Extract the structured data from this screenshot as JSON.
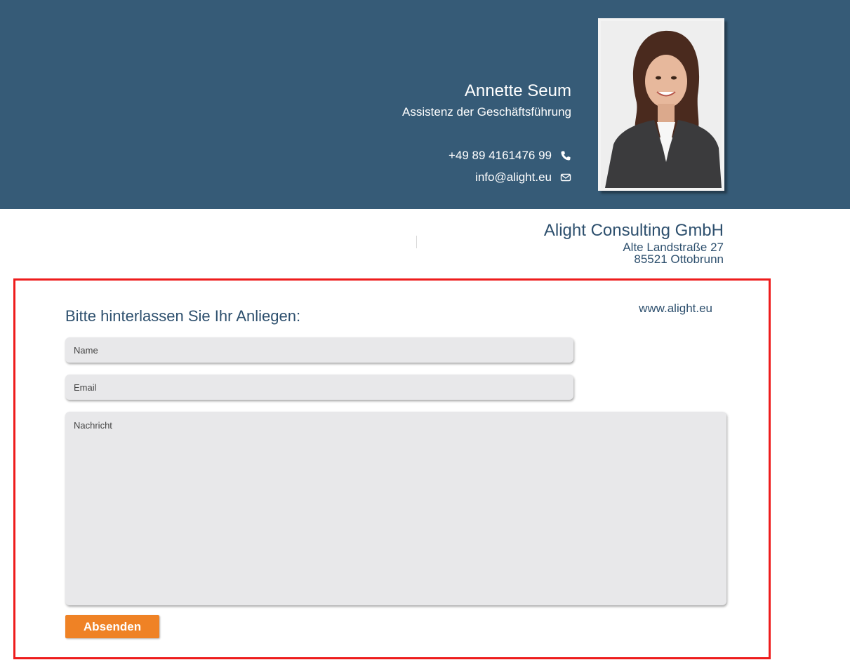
{
  "header": {
    "name": "Annette Seum",
    "role": "Assistenz der Geschäftsführung",
    "phone": "+49 89 4161476 99",
    "email": "info@alight.eu",
    "phone_icon": "phone-icon",
    "mail_icon": "envelope-icon",
    "background_color": "#365b77"
  },
  "company": {
    "name": "Alight Consulting GmbH",
    "street": "Alte Landstraße 27",
    "city": "85521 Ottobrunn",
    "website": "www.alight.eu"
  },
  "form": {
    "title": "Bitte hinterlassen Sie Ihr Anliegen:",
    "name_placeholder": "Name",
    "email_placeholder": "Email",
    "message_placeholder": "Nachricht",
    "submit_label": "Absenden",
    "submit_color": "#ef8225",
    "highlight_border_color": "#ee1c1c"
  }
}
